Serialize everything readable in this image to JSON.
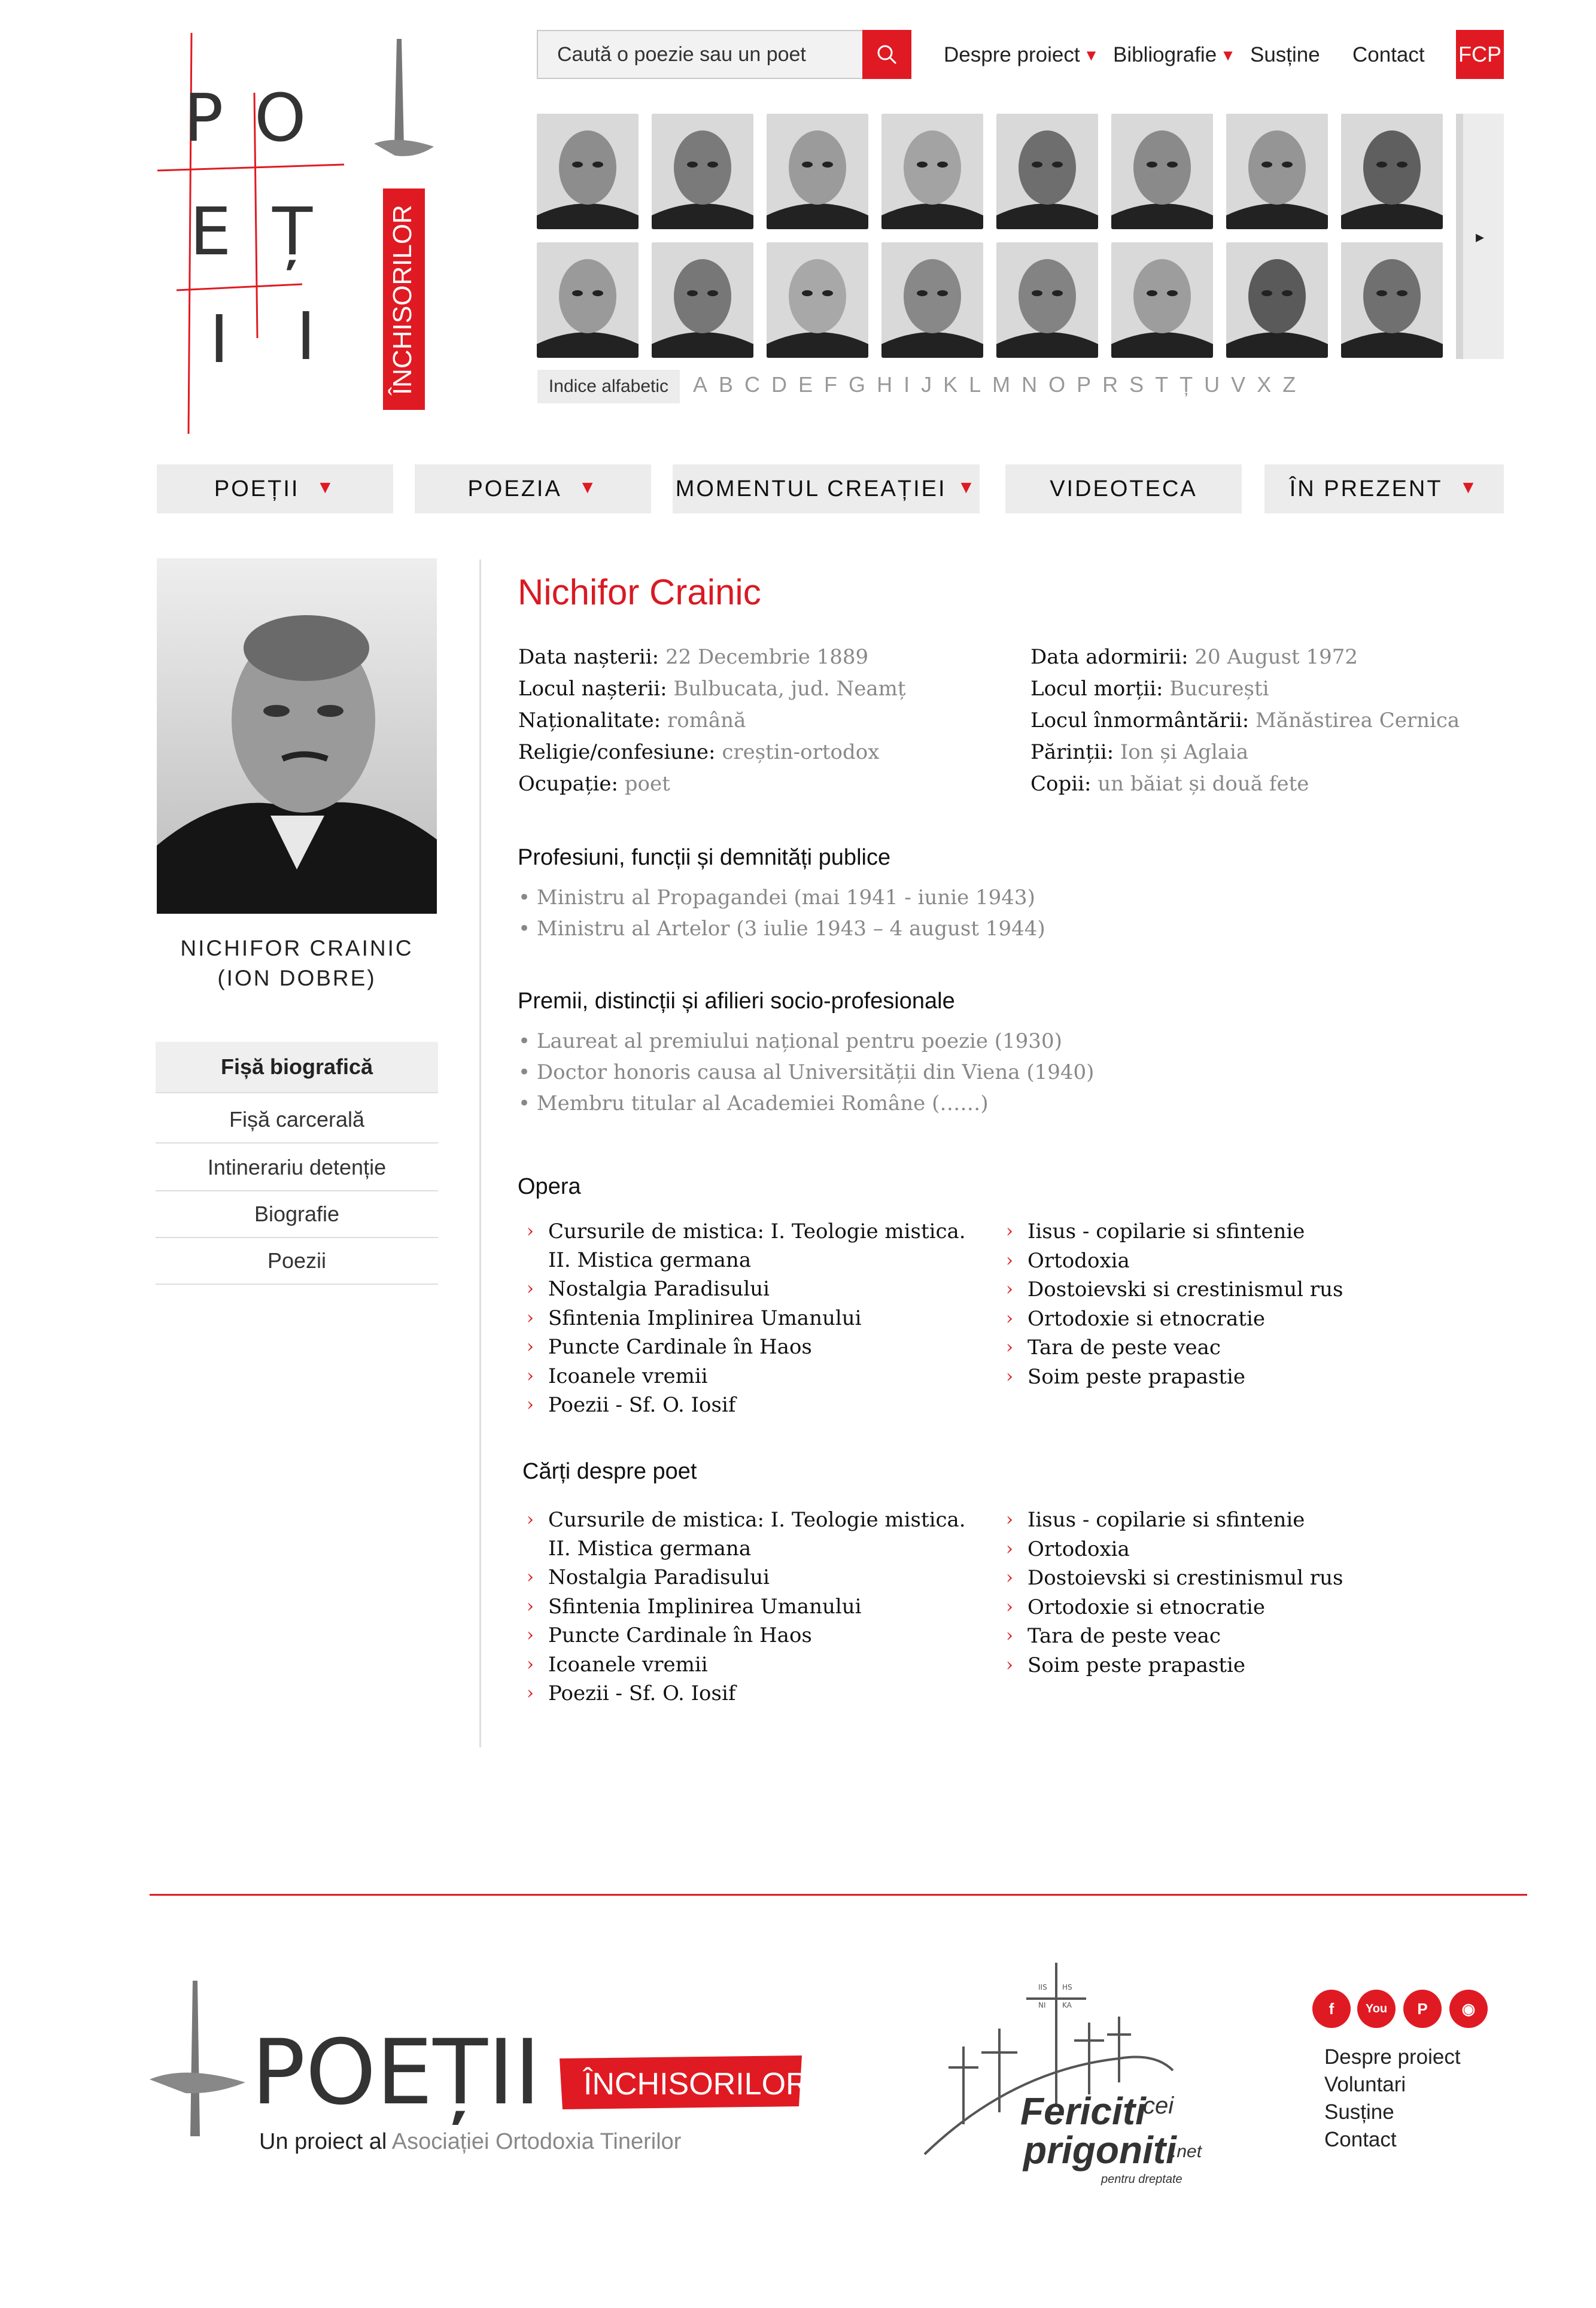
{
  "header": {
    "logo_letters": [
      "P",
      "O",
      "E",
      "Ț",
      "I",
      "I"
    ],
    "logo_banner": "ÎNCHISORILOR",
    "search_placeholder": "Caută o poezie sau un poet",
    "nav": [
      {
        "label": "Despre proiect",
        "dropdown": true
      },
      {
        "label": "Bibliografie",
        "dropdown": true
      },
      {
        "label": "Susține",
        "dropdown": false
      },
      {
        "label": "Contact",
        "dropdown": false
      }
    ],
    "fcp": "FCP",
    "alpha_label": "Indice alfabetic",
    "alphabet": [
      "A",
      "B",
      "C",
      "D",
      "E",
      "F",
      "G",
      "H",
      "I",
      "J",
      "K",
      "L",
      "M",
      "N",
      "O",
      "P",
      "R",
      "S",
      "T",
      "Ț",
      "U",
      "V",
      "X",
      "Z"
    ],
    "scroll_icon": "▸"
  },
  "main_nav": [
    {
      "label": "POEȚII",
      "dropdown": true
    },
    {
      "label": "POEZIA",
      "dropdown": true
    },
    {
      "label": "MOMENTUL CREAȚIEI",
      "dropdown": true
    },
    {
      "label": "VIDEOTECA",
      "dropdown": false
    },
    {
      "label": "ÎN PREZENT",
      "dropdown": true
    }
  ],
  "sidebar": {
    "caption_line1": "NICHIFOR CRAINIC",
    "caption_line2": "(ION DOBRE)",
    "items": [
      "Fișă biografică",
      "Fișă carcerală",
      "Intinerariu detenție",
      "Biografie",
      "Poezii"
    ]
  },
  "poet": {
    "name": "Nichifor Crainic",
    "left_fields": [
      {
        "label": "Data nașterii:",
        "value": "22 Decembrie 1889"
      },
      {
        "label": "Locul nașterii:",
        "value": "Bulbucata, jud. Neamț"
      },
      {
        "label": "Naționalitate:",
        "value": "română"
      },
      {
        "label": "Religie/confesiune:",
        "value": "creștin-ortodox"
      },
      {
        "label": "Ocupație:",
        "value": "poet"
      }
    ],
    "right_fields": [
      {
        "label": "Data adormirii:",
        "value": "20 August 1972"
      },
      {
        "label": "Locul morții:",
        "value": "București"
      },
      {
        "label": "Locul înmormântării:",
        "value": "Mănăstirea Cernica"
      },
      {
        "label": "Părinții:",
        "value": "Ion și Aglaia"
      },
      {
        "label": "Copii:",
        "value": "un băiat și două fete"
      }
    ]
  },
  "professions": {
    "title": "Profesiuni, funcții și demnități publice",
    "items": [
      "• Ministru al Propagandei (mai 1941 - iunie 1943)",
      "• Ministru al Artelor (3 iulie 1943 – 4 august 1944)"
    ]
  },
  "awards": {
    "title": "Premii, distincții și afilieri socio-profesionale",
    "items": [
      "• Laureat al premiului național pentru poezie (1930)",
      "• Doctor honoris causa al Universității din Viena (1940)",
      "• Membru titular al Academiei Române (……)"
    ]
  },
  "opera": {
    "title": "Opera",
    "left": [
      "Cursurile de mistica: I. Teologie mistica. II. Mistica germana",
      "Nostalgia Paradisului",
      "Sfintenia Implinirea Umanului",
      "Puncte Cardinale în Haos",
      "Icoanele vremii",
      "Poezii - Sf. O. Iosif"
    ],
    "right": [
      "Iisus - copilarie si sfintenie",
      "Ortodoxia",
      "Dostoievski si crestinismul rus",
      "Ortodoxie si etnocratie",
      "Tara de peste veac",
      "Soim peste prapastie"
    ]
  },
  "books": {
    "title": "Cărți despre poet",
    "left": [
      "Cursurile de mistica: I. Teologie mistica. II. Mistica germana",
      "Nostalgia Paradisului",
      "Sfintenia Implinirea Umanului",
      "Puncte Cardinale în Haos",
      "Icoanele vremii",
      "Poezii - Sf. O. Iosif"
    ],
    "right": [
      "Iisus - copilarie si sfintenie",
      "Ortodoxia",
      "Dostoievski si crestinismul rus",
      "Ortodoxie si etnocratie",
      "Tara de peste veac",
      "Soim peste prapastie"
    ]
  },
  "footer": {
    "logo_word": "POEȚII",
    "logo_banner": "ÎNCHISORILOR",
    "tagline_prefix": "Un proiect al",
    "tagline_org": "Asociației Ortodoxia Tinerilor",
    "fcp_line1": "Fericiti",
    "fcp_cei": "cei",
    "fcp_line2": "prigoniti",
    "fcp_net": ".net",
    "fcp_sub": "pentru dreptate",
    "cross_text": [
      "IIS",
      "HS",
      "NI",
      "KA"
    ],
    "social": [
      {
        "icon": "facebook-icon",
        "glyph": "f"
      },
      {
        "icon": "youtube-icon",
        "glyph": "You"
      },
      {
        "icon": "paypal-icon",
        "glyph": "P"
      },
      {
        "icon": "rss-icon",
        "glyph": "◉"
      }
    ],
    "links": [
      "Despre proiect",
      "Voluntari",
      "Susține",
      "Contact"
    ]
  },
  "colors": {
    "accent": "#e01a22",
    "gray_text": "#888888",
    "panel": "#ececec"
  }
}
